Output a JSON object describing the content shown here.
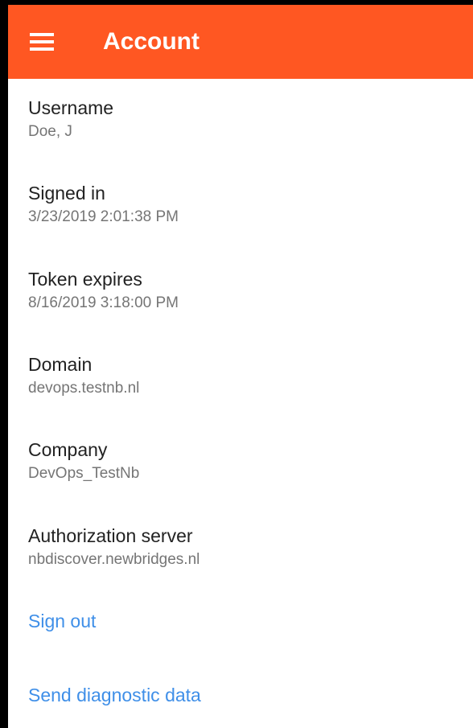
{
  "app_bar": {
    "title": "Account",
    "background_color": "#ff5722",
    "menu_icon": "hamburger-menu-icon"
  },
  "account": {
    "fields": [
      {
        "label": "Username",
        "value": "Doe, J"
      },
      {
        "label": "Signed in",
        "value": "3/23/2019 2:01:38 PM"
      },
      {
        "label": "Token expires",
        "value": "8/16/2019 3:18:00 PM"
      },
      {
        "label": "Domain",
        "value": "devops.testnb.nl"
      },
      {
        "label": "Company",
        "value": "DevOps_TestNb"
      },
      {
        "label": "Authorization server",
        "value": "nbdiscover.newbridges.nl"
      }
    ]
  },
  "actions": {
    "sign_out": "Sign out",
    "send_diagnostic_data": "Send diagnostic data",
    "link_color": "#3f8fe8"
  }
}
